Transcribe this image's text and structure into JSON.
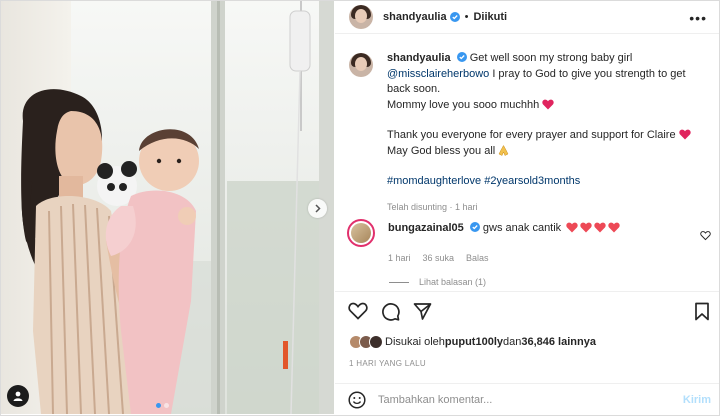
{
  "colors": {
    "accent": "#0095f6",
    "heart": "#ed4956",
    "link": "#00376b",
    "muted": "#8e8e8e"
  },
  "header": {
    "username": "shandyaulia",
    "separator": "•",
    "follow_status": "Diikuti",
    "more_icon": "more-horizontal-icon"
  },
  "caption": {
    "username": "shandyaulia",
    "line1": "Get well soon my strong baby girl",
    "mention": "@missclaireherbowo",
    "line2": " I pray to God to give you strength to get back soon.",
    "line3": "Mommy love you sooo muchhh",
    "line4": "Thank you everyone for every prayer and support for Claire",
    "line5": " May God bless you all",
    "hashtag1": "#momdaughterlove",
    "hashtag2": "#2yearsold3months",
    "edited": "Telah disunting · 1 hari"
  },
  "comment": {
    "username": "bungazainal05",
    "text": "gws anak cantik",
    "hearts": 4,
    "time": "1 hari",
    "likes": "36 suka",
    "reply": "Balas",
    "view_replies": "Lihat balasan (1)"
  },
  "actions": [
    "heart-icon",
    "comment-icon",
    "share-icon",
    "bookmark-icon"
  ],
  "likes": {
    "prefix": "Disukai oleh ",
    "user": "puput100ly",
    "middle": " dan ",
    "count": "36,846 lainnya"
  },
  "time_ago": "1 HARI YANG LALU",
  "add_comment": {
    "placeholder": "Tambahkan komentar...",
    "post_label": "Kirim"
  },
  "carousel": {
    "total": 2,
    "active_index": 0
  }
}
